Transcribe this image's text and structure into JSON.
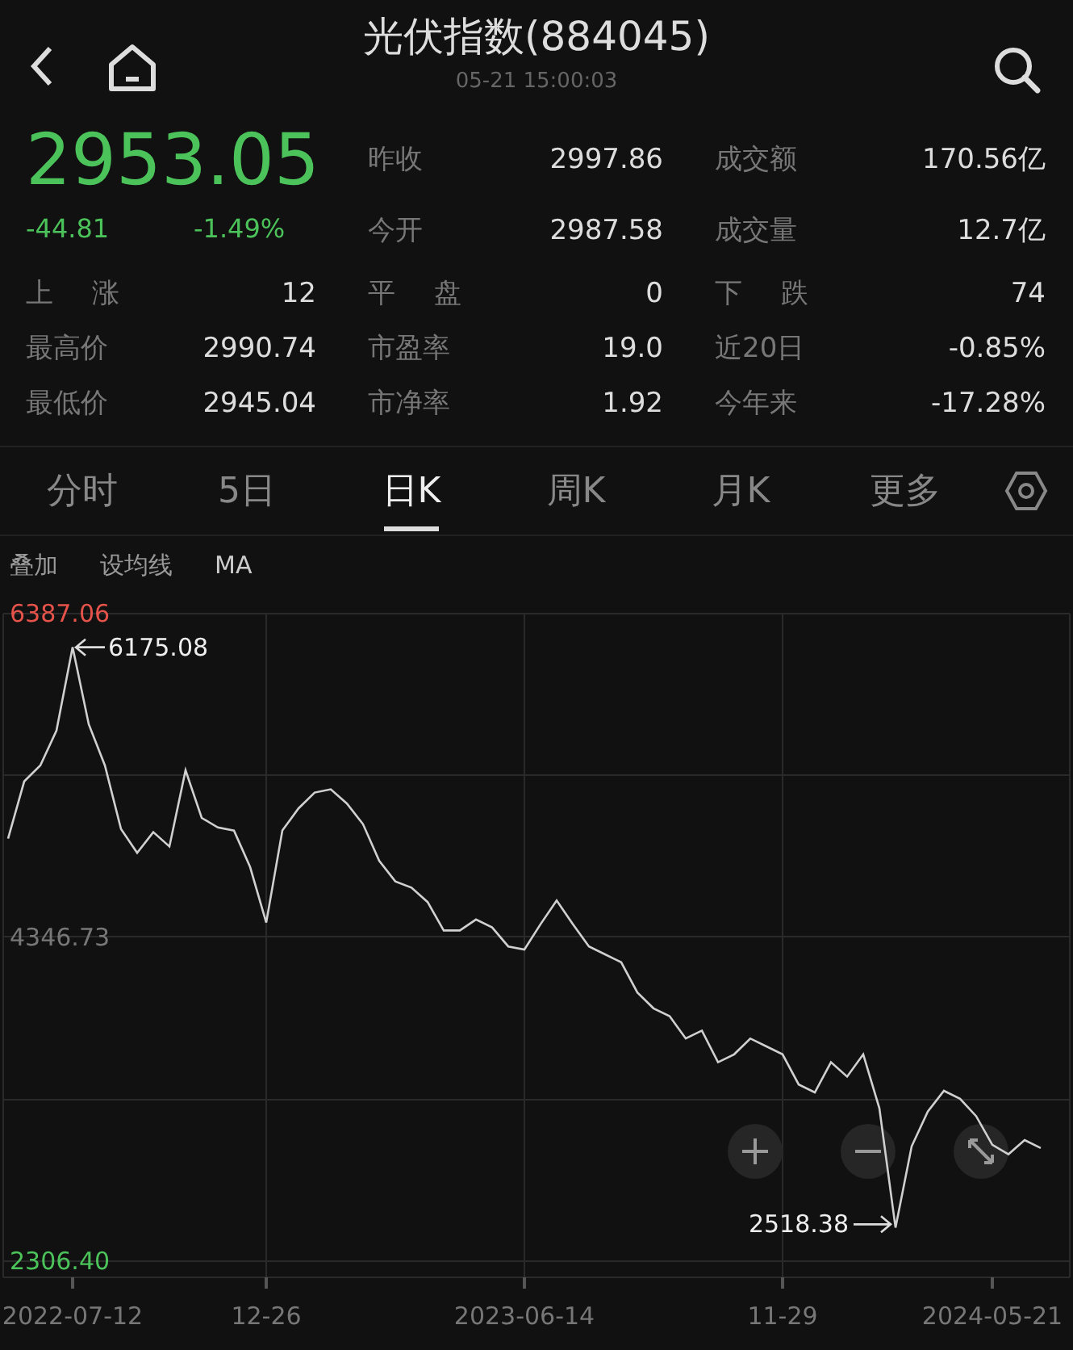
{
  "header": {
    "title": "光伏指数(884045)",
    "time": "05-21 15:00:03"
  },
  "quote": {
    "price": "2953.05",
    "change": "-44.81",
    "change_pct": "-1.49%",
    "fields": [
      {
        "label": "昨收",
        "value": "2997.86"
      },
      {
        "label": "成交额",
        "value": "170.56亿"
      },
      {
        "label": "今开",
        "value": "2987.58"
      },
      {
        "label": "成交量",
        "value": "12.7亿"
      }
    ]
  },
  "stats": [
    {
      "label": "上涨",
      "value": "12"
    },
    {
      "label": "平盘",
      "value": "0"
    },
    {
      "label": "下跌",
      "value": "74"
    },
    {
      "label": "最高价",
      "value": "2990.74"
    },
    {
      "label": "市盈率",
      "value": "19.0"
    },
    {
      "label": "近20日",
      "value": "-0.85%"
    },
    {
      "label": "最低价",
      "value": "2945.04"
    },
    {
      "label": "市净率",
      "value": "1.92"
    },
    {
      "label": "今年来",
      "value": "-17.28%"
    }
  ],
  "tabs": [
    {
      "label": "分时",
      "selected": false
    },
    {
      "label": "5日",
      "selected": false
    },
    {
      "label": "日K",
      "selected": true
    },
    {
      "label": "周K",
      "selected": false
    },
    {
      "label": "月K",
      "selected": false
    },
    {
      "label": "更多",
      "selected": false
    }
  ],
  "toolbar": [
    "叠加",
    "设均线",
    "MA"
  ],
  "chart": {
    "chart_data": {
      "type": "line",
      "categories": [
        null,
        null,
        null,
        null,
        "2022-07-12",
        null,
        null,
        null,
        null,
        null,
        null,
        null,
        null,
        null,
        null,
        null,
        "12-26",
        null,
        null,
        null,
        null,
        null,
        null,
        null,
        null,
        null,
        null,
        null,
        null,
        null,
        null,
        null,
        "2023-06-14",
        null,
        null,
        null,
        null,
        null,
        null,
        null,
        null,
        null,
        null,
        null,
        null,
        null,
        null,
        null,
        "11-29",
        null,
        null,
        null,
        null,
        null,
        null,
        null,
        null,
        null,
        null,
        null,
        null,
        "2024-05-21",
        null,
        null,
        null
      ],
      "series": [
        {
          "color": "#d0d0d0",
          "values": [
            4970,
            5330,
            5430,
            5650,
            6175.08,
            5690,
            5430,
            5030,
            4880,
            5010,
            4920,
            5400,
            5100,
            5040,
            5020,
            4790,
            4440,
            5020,
            5160,
            5260,
            5280,
            5190,
            5060,
            4830,
            4700,
            4660,
            4570,
            4390,
            4390,
            4460,
            4410,
            4290,
            4270,
            4430,
            4580,
            4430,
            4290,
            4240,
            4190,
            4000,
            3900,
            3850,
            3710,
            3760,
            3560,
            3610,
            3710,
            3660,
            3610,
            3420,
            3370,
            3560,
            3470,
            3610,
            3270,
            2518.38,
            3030,
            3250,
            3380,
            3330,
            3220,
            3040,
            2980,
            3070,
            3020
          ]
        }
      ],
      "ylim": [
        2306.4,
        6387.06
      ],
      "grid": true,
      "yticks": [
        {
          "value": 6387.06,
          "label": "6387.06"
        },
        {
          "value": 4346.73,
          "label": "4346.73"
        },
        {
          "value": 2306.4,
          "label": "2306.40"
        }
      ],
      "annotations": [
        "6175.08",
        "2518.38"
      ]
    }
  }
}
